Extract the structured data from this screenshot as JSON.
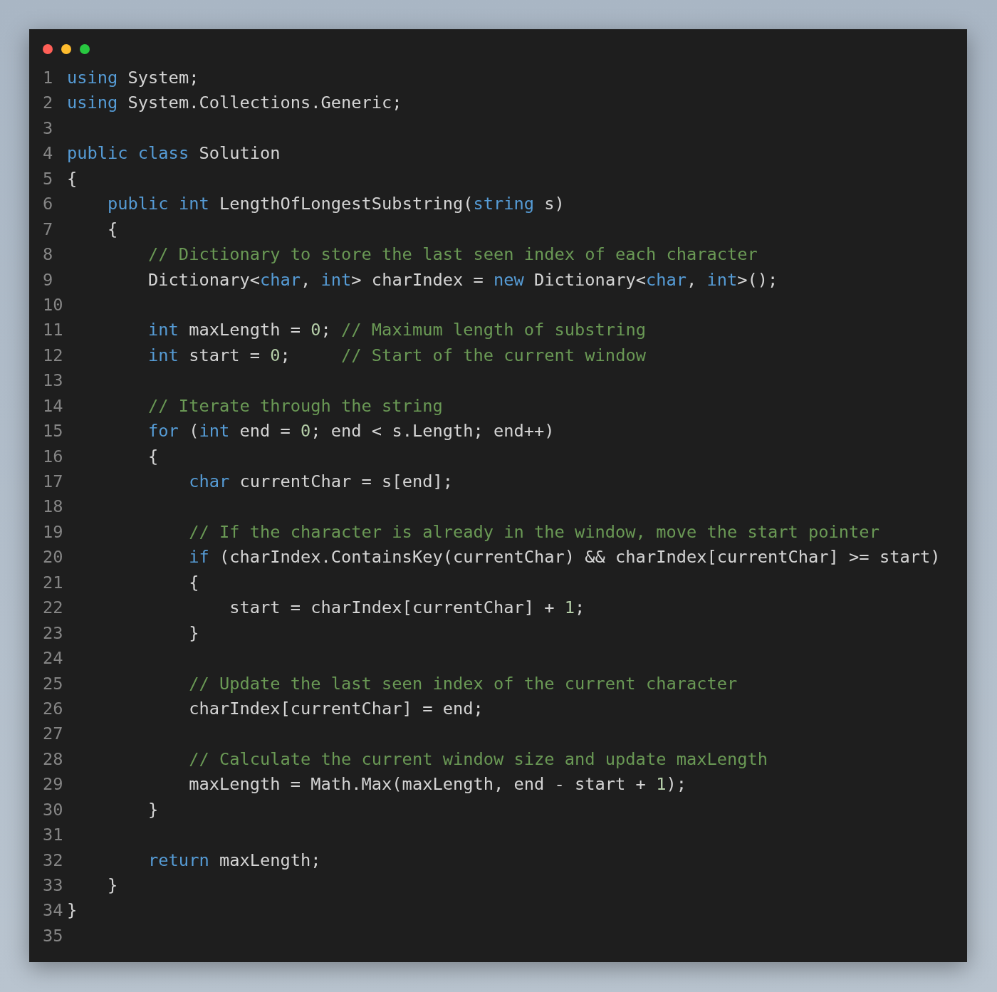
{
  "editor": {
    "lines": [
      {
        "number": "1",
        "tokens": [
          {
            "kind": "keyword",
            "text": "using"
          },
          {
            "kind": "plain",
            "text": " System;"
          }
        ]
      },
      {
        "number": "2",
        "tokens": [
          {
            "kind": "keyword",
            "text": "using"
          },
          {
            "kind": "plain",
            "text": " System.Collections.Generic;"
          }
        ]
      },
      {
        "number": "3"
      },
      {
        "number": "4",
        "tokens": [
          {
            "kind": "keyword",
            "text": "public"
          },
          {
            "kind": "keyword",
            "text": " class"
          },
          {
            "kind": "plain",
            "text": " Solution"
          }
        ]
      },
      {
        "number": "5",
        "tokens": [
          {
            "kind": "plain",
            "text": "{"
          }
        ]
      },
      {
        "number": "6",
        "tokens": [
          {
            "kind": "keyword",
            "text": "    public"
          },
          {
            "kind": "keyword",
            "text": " int"
          },
          {
            "kind": "plain",
            "text": " LengthOfLongestSubstring("
          },
          {
            "kind": "keyword",
            "text": "string"
          },
          {
            "kind": "plain",
            "text": " s)"
          }
        ]
      },
      {
        "number": "7",
        "tokens": [
          {
            "kind": "plain",
            "text": "    {"
          }
        ]
      },
      {
        "number": "8",
        "tokens": [
          {
            "kind": "comment",
            "text": "        // Dictionary to store the last seen index of each character"
          }
        ]
      },
      {
        "number": "9",
        "tokens": [
          {
            "kind": "plain",
            "text": "        Dictionary<"
          },
          {
            "kind": "keyword",
            "text": "char"
          },
          {
            "kind": "plain",
            "text": ", "
          },
          {
            "kind": "keyword",
            "text": "int"
          },
          {
            "kind": "plain",
            "text": "> charIndex = "
          },
          {
            "kind": "keyword",
            "text": "new"
          },
          {
            "kind": "plain",
            "text": " Dictionary<"
          },
          {
            "kind": "keyword",
            "text": "char"
          },
          {
            "kind": "plain",
            "text": ", "
          },
          {
            "kind": "keyword",
            "text": "int"
          },
          {
            "kind": "plain",
            "text": ">();"
          }
        ]
      },
      {
        "number": "10"
      },
      {
        "number": "11",
        "tokens": [
          {
            "kind": "keyword",
            "text": "        int"
          },
          {
            "kind": "plain",
            "text": " maxLength = "
          },
          {
            "kind": "number",
            "text": "0"
          },
          {
            "kind": "plain",
            "text": "; "
          },
          {
            "kind": "comment",
            "text": "// Maximum length of substring"
          }
        ]
      },
      {
        "number": "12",
        "tokens": [
          {
            "kind": "keyword",
            "text": "        int"
          },
          {
            "kind": "plain",
            "text": " start = "
          },
          {
            "kind": "number",
            "text": "0"
          },
          {
            "kind": "plain",
            "text": ";     "
          },
          {
            "kind": "comment",
            "text": "// Start of the current window"
          }
        ]
      },
      {
        "number": "13"
      },
      {
        "number": "14",
        "tokens": [
          {
            "kind": "comment",
            "text": "        // Iterate through the string"
          }
        ]
      },
      {
        "number": "15",
        "tokens": [
          {
            "kind": "keyword",
            "text": "        for"
          },
          {
            "kind": "plain",
            "text": " ("
          },
          {
            "kind": "keyword",
            "text": "int"
          },
          {
            "kind": "plain",
            "text": " end = "
          },
          {
            "kind": "number",
            "text": "0"
          },
          {
            "kind": "plain",
            "text": "; end < s.Length; end++)"
          }
        ]
      },
      {
        "number": "16",
        "tokens": [
          {
            "kind": "plain",
            "text": "        {"
          }
        ]
      },
      {
        "number": "17",
        "tokens": [
          {
            "kind": "keyword",
            "text": "            char"
          },
          {
            "kind": "plain",
            "text": " currentChar = s[end];"
          }
        ]
      },
      {
        "number": "18"
      },
      {
        "number": "19",
        "tokens": [
          {
            "kind": "comment",
            "text": "            // If the character is already in the window, move the start pointer"
          }
        ]
      },
      {
        "number": "20",
        "tokens": [
          {
            "kind": "keyword",
            "text": "            if"
          },
          {
            "kind": "plain",
            "text": " (charIndex.ContainsKey(currentChar) && charIndex[currentChar] >= start)"
          }
        ]
      },
      {
        "number": "21",
        "tokens": [
          {
            "kind": "plain",
            "text": "            {"
          }
        ]
      },
      {
        "number": "22",
        "tokens": [
          {
            "kind": "plain",
            "text": "                start = charIndex[currentChar] + "
          },
          {
            "kind": "number",
            "text": "1"
          },
          {
            "kind": "plain",
            "text": ";"
          }
        ]
      },
      {
        "number": "23",
        "tokens": [
          {
            "kind": "plain",
            "text": "            }"
          }
        ]
      },
      {
        "number": "24"
      },
      {
        "number": "25",
        "tokens": [
          {
            "kind": "comment",
            "text": "            // Update the last seen index of the current character"
          }
        ]
      },
      {
        "number": "26",
        "tokens": [
          {
            "kind": "plain",
            "text": "            charIndex[currentChar] = end;"
          }
        ]
      },
      {
        "number": "27"
      },
      {
        "number": "28",
        "tokens": [
          {
            "kind": "comment",
            "text": "            // Calculate the current window size and update maxLength"
          }
        ]
      },
      {
        "number": "29",
        "tokens": [
          {
            "kind": "plain",
            "text": "            maxLength = Math.Max(maxLength, end - start + "
          },
          {
            "kind": "number",
            "text": "1"
          },
          {
            "kind": "plain",
            "text": ");"
          }
        ]
      },
      {
        "number": "30",
        "tokens": [
          {
            "kind": "plain",
            "text": "        }"
          }
        ]
      },
      {
        "number": "31"
      },
      {
        "number": "32",
        "tokens": [
          {
            "kind": "keyword",
            "text": "        return"
          },
          {
            "kind": "plain",
            "text": " maxLength;"
          }
        ]
      },
      {
        "number": "33",
        "tokens": [
          {
            "kind": "plain",
            "text": "    }"
          }
        ]
      },
      {
        "number": "34",
        "tokens": [
          {
            "kind": "plain",
            "text": "}"
          }
        ]
      },
      {
        "number": "35"
      }
    ]
  }
}
